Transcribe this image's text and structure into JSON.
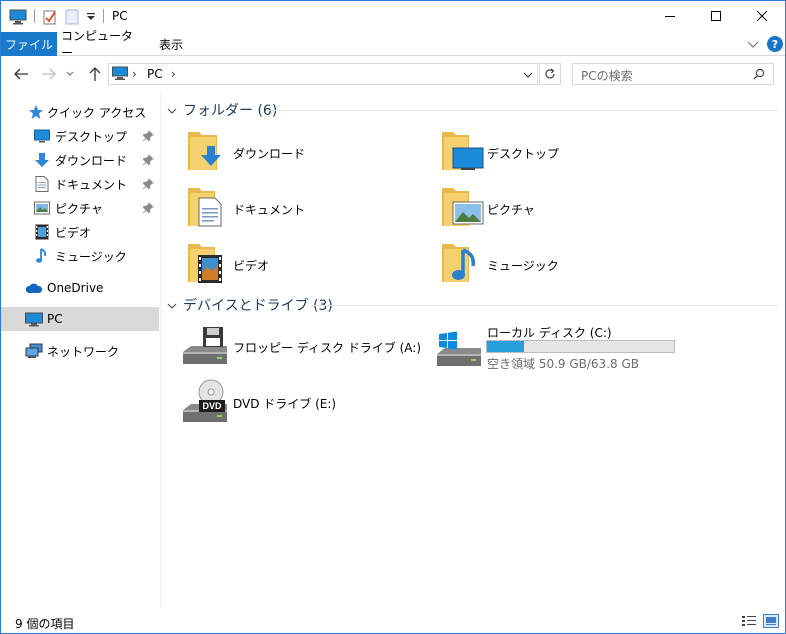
{
  "window": {
    "title": "PC"
  },
  "ribbon": {
    "file_tab": "ファイル",
    "computer_tab": "コンピューター",
    "view_tab": "表示",
    "help": "?"
  },
  "address": {
    "location": "PC",
    "search_placeholder": "PCの検索"
  },
  "nav": {
    "quick_access": "クイック アクセス",
    "quick_items": [
      {
        "label": "デスクトップ",
        "icon": "desktop-icon"
      },
      {
        "label": "ダウンロード",
        "icon": "download-icon"
      },
      {
        "label": "ドキュメント",
        "icon": "document-icon"
      },
      {
        "label": "ピクチャ",
        "icon": "picture-icon"
      },
      {
        "label": "ビデオ",
        "icon": "video-icon"
      },
      {
        "label": "ミュージック",
        "icon": "music-icon"
      }
    ],
    "onedrive": "OneDrive",
    "pc": "PC",
    "network": "ネットワーク"
  },
  "folders": {
    "header": "フォルダー (6)",
    "items": [
      {
        "label": "ダウンロード",
        "icon": "download-folder-icon"
      },
      {
        "label": "デスクトップ",
        "icon": "desktop-folder-icon"
      },
      {
        "label": "ドキュメント",
        "icon": "documents-folder-icon"
      },
      {
        "label": "ピクチャ",
        "icon": "pictures-folder-icon"
      },
      {
        "label": "ビデオ",
        "icon": "videos-folder-icon"
      },
      {
        "label": "ミュージック",
        "icon": "music-folder-icon"
      }
    ]
  },
  "devices": {
    "header": "デバイスとドライブ (3)",
    "floppy": "フロッピー ディスク ドライブ (A:)",
    "local": "ローカル ディスク (C:)",
    "local_free": "空き領域 50.9 GB/63.8 GB",
    "local_used_fraction": 0.2,
    "dvd": "DVD ドライブ (E:)",
    "dvd_badge": "DVD"
  },
  "status": {
    "count": "9 個の項目"
  },
  "colors": {
    "accent": "#1979ca",
    "drive_fill": "#26a0da",
    "folder": "#f5c85d"
  }
}
